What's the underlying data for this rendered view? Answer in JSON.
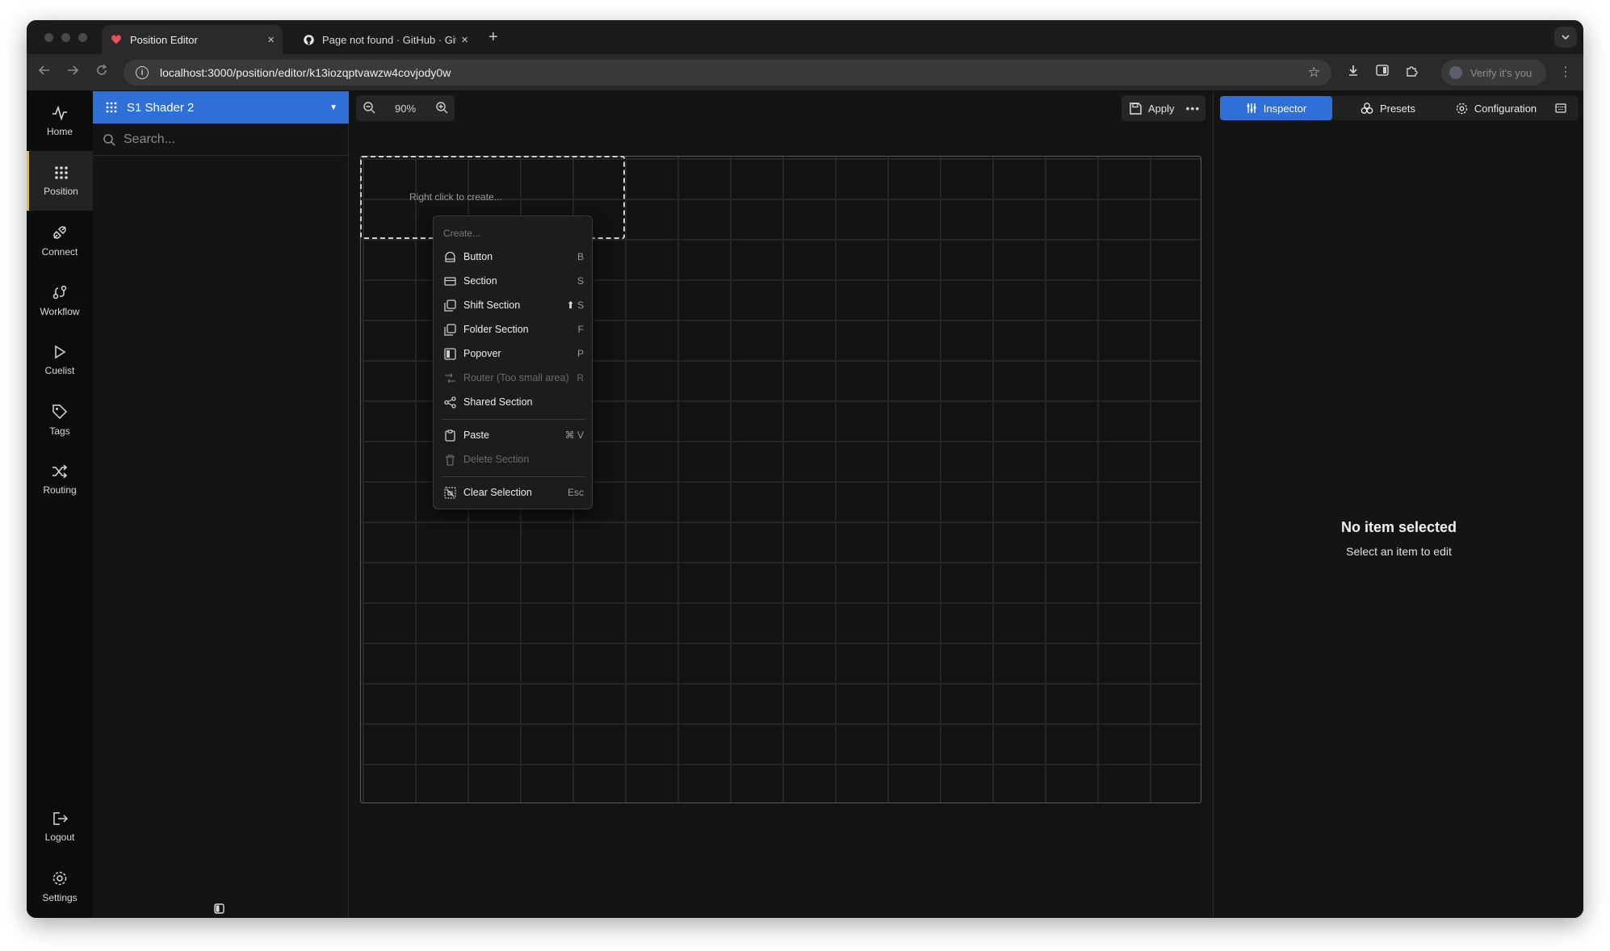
{
  "browser": {
    "tabs": [
      {
        "title": "Position Editor",
        "close": "×"
      },
      {
        "title": "Page not found · GitHub · GitH",
        "close": "×"
      }
    ],
    "new_tab": "+",
    "url": "localhost:3000/position/editor/k13iozqptvawzw4covjody0w",
    "profile_chip": "Verify it's you"
  },
  "rail": {
    "items": [
      {
        "label": "Home"
      },
      {
        "label": "Position"
      },
      {
        "label": "Connect"
      },
      {
        "label": "Workflow"
      },
      {
        "label": "Cuelist"
      },
      {
        "label": "Tags"
      },
      {
        "label": "Routing"
      }
    ],
    "bottom": [
      {
        "label": "Logout"
      },
      {
        "label": "Settings"
      }
    ],
    "active_color": "#f2b637"
  },
  "sidebar": {
    "selected_name": "S1 Shader 2",
    "search_placeholder": "Search..."
  },
  "canvas": {
    "zoom": "90%",
    "apply_label": "Apply",
    "hint": "Right click to create..."
  },
  "context_menu": {
    "header": "Create...",
    "items": [
      {
        "label": "Button",
        "shortcut": "B",
        "disabled": false
      },
      {
        "label": "Section",
        "shortcut": "S",
        "disabled": false
      },
      {
        "label": "Shift Section",
        "shortcut": "S",
        "disabled": false
      },
      {
        "label": "Folder Section",
        "shortcut": "F",
        "disabled": false
      },
      {
        "label": "Popover",
        "shortcut": "P",
        "disabled": false
      },
      {
        "label": "Router (Too small area)",
        "shortcut": "R",
        "disabled": true
      },
      {
        "label": "Shared Section",
        "shortcut": "",
        "disabled": false
      }
    ],
    "items2": [
      {
        "label": "Paste",
        "shortcut": "⌘ V",
        "disabled": false
      },
      {
        "label": "Delete Section",
        "shortcut": "",
        "disabled": true
      }
    ],
    "items3": [
      {
        "label": "Clear Selection",
        "shortcut": "Esc",
        "disabled": false
      }
    ]
  },
  "panel": {
    "tabs": [
      {
        "label": "Inspector"
      },
      {
        "label": "Presets"
      },
      {
        "label": "Configuration"
      }
    ],
    "empty_title": "No item selected",
    "empty_subtitle": "Select an item to edit"
  },
  "colors": {
    "accent": "#2f6fd8",
    "rail_active": "#f2b637"
  }
}
